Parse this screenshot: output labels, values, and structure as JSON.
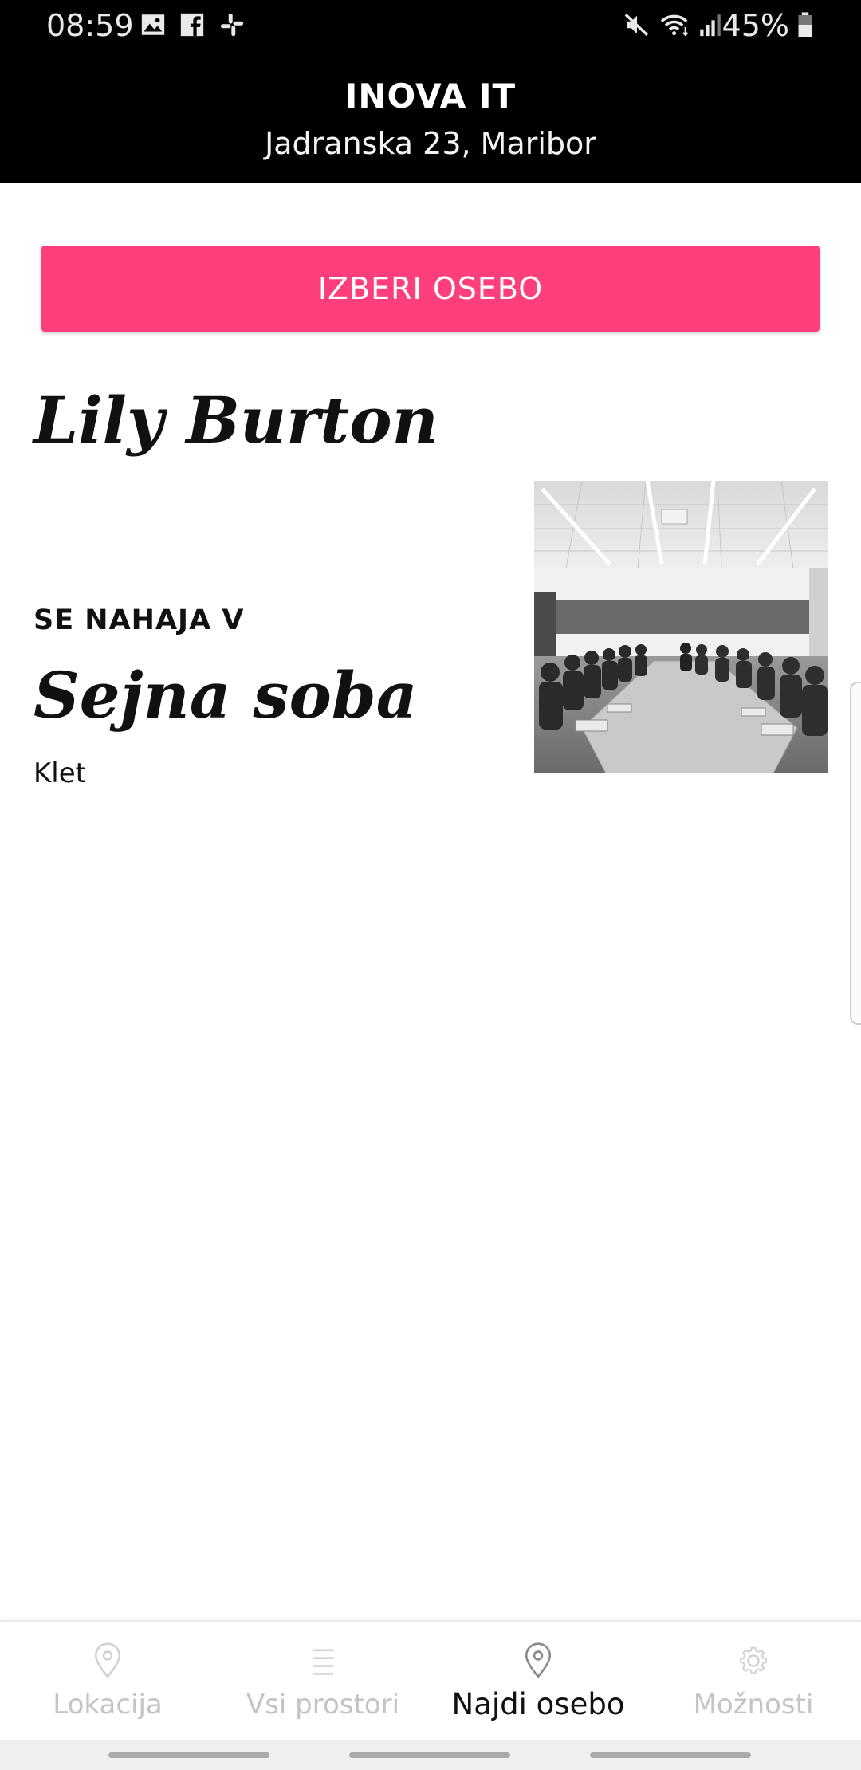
{
  "status_bar": {
    "time": "08:59",
    "battery": "45%",
    "icons": [
      "image-icon",
      "facebook-icon",
      "slack-icon",
      "mute-icon",
      "wifi-icon",
      "signal-icon",
      "battery-icon"
    ]
  },
  "header": {
    "title": "INOVA IT",
    "subtitle": "Jadranska 23, Maribor"
  },
  "main": {
    "pick_button_label": "IZBERI OSEBO",
    "person_name": "Lily Burton",
    "located_label": "SE NAHAJA V",
    "room_name": "Sejna soba",
    "room_floor": "Klet"
  },
  "bottom_nav": {
    "items": [
      {
        "label": "Lokacija",
        "icon": "location-pin-icon",
        "active": false
      },
      {
        "label": "Vsi prostori",
        "icon": "list-icon",
        "active": false
      },
      {
        "label": "Najdi osebo",
        "icon": "location-pin-icon",
        "active": true
      },
      {
        "label": "Možnosti",
        "icon": "gear-icon",
        "active": false
      }
    ]
  },
  "colors": {
    "accent": "#ff3f7c",
    "header_bg": "#000000",
    "inactive_nav": "#c4c4c4"
  }
}
